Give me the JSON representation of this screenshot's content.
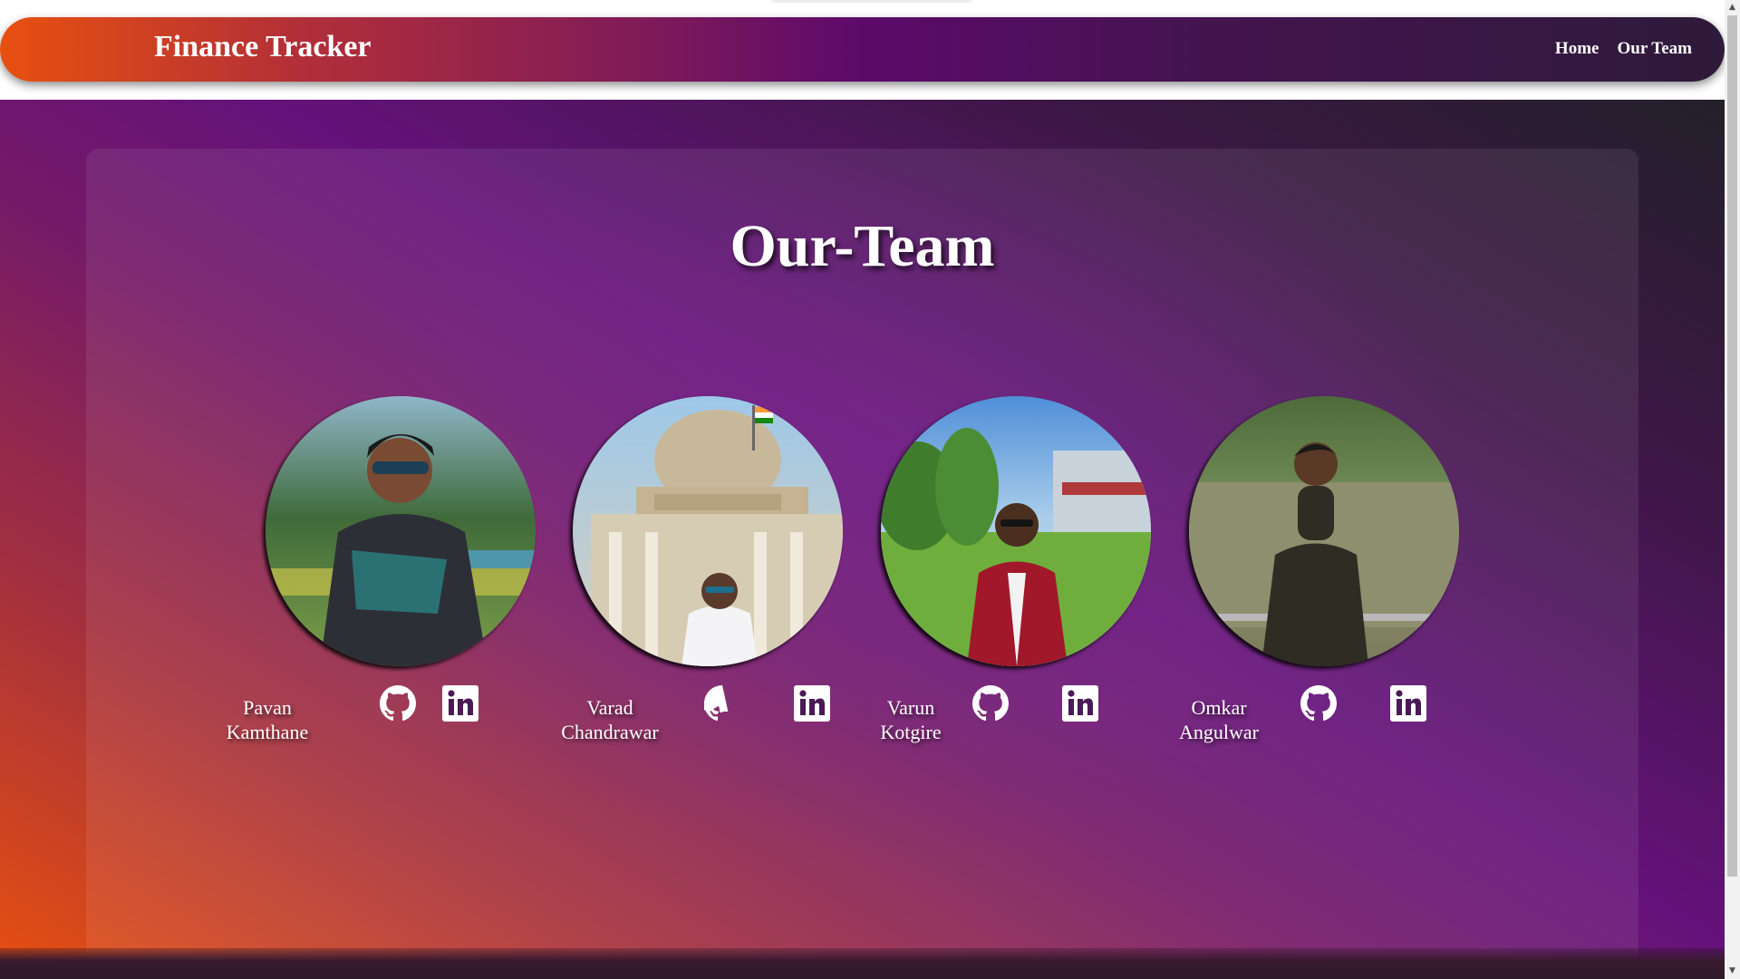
{
  "navbar": {
    "brand": "Finance Tracker",
    "links": [
      {
        "label": "Home"
      },
      {
        "label": "Our Team"
      }
    ]
  },
  "team": {
    "title": "Our-Team",
    "members": [
      {
        "first_name": "Pavan",
        "last_name": "Kamthane",
        "photo": "profile-photo",
        "github_icon": "github-icon",
        "linkedin_icon": "linkedin-icon"
      },
      {
        "first_name": "Varad",
        "last_name": "Chandrawar",
        "photo": "profile-photo",
        "github_icon": "github-icon",
        "linkedin_icon": "linkedin-icon"
      },
      {
        "first_name": "Varun",
        "last_name": "Kotgire",
        "photo": "profile-photo",
        "github_icon": "github-icon",
        "linkedin_icon": "linkedin-icon"
      },
      {
        "first_name": "Omkar",
        "last_name": "Angulwar",
        "photo": "profile-photo",
        "github_icon": "github-icon",
        "linkedin_icon": "linkedin-icon"
      }
    ]
  },
  "colors": {
    "gradient_start": "#e8500f",
    "gradient_mid": "#65127a",
    "gradient_end": "#23202a",
    "text": "#ffffff"
  }
}
